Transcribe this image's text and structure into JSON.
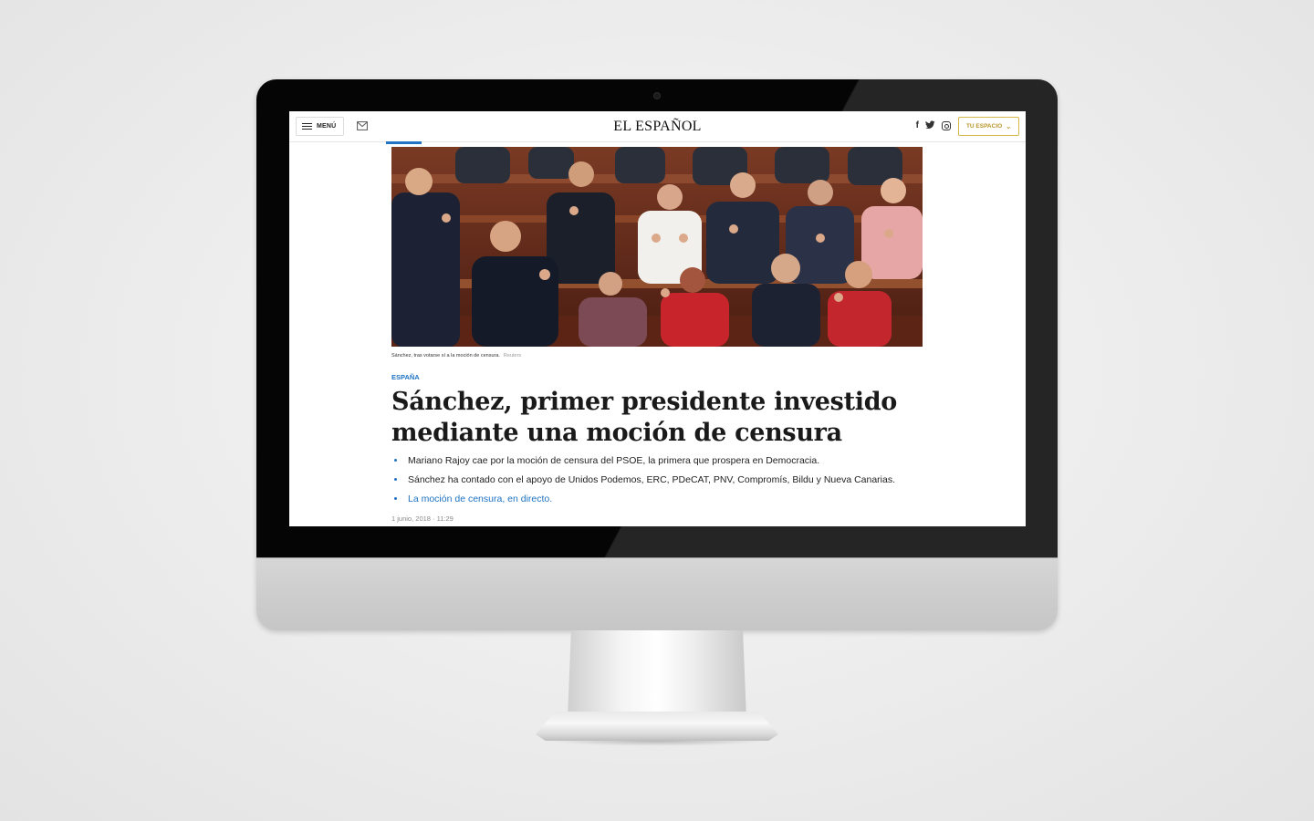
{
  "header": {
    "menu_label": "MENÚ",
    "logo": "EL ESPAÑOL",
    "tu_espacio_label": "TU ESPACIO",
    "social": [
      "facebook-icon",
      "twitter-icon",
      "instagram-icon"
    ]
  },
  "article": {
    "caption": "Sánchez, tras votarse sí a la moción de censura.",
    "credit": "Reuters",
    "section": "ESPAÑA",
    "headline_line1": "Sánchez, primer presidente investido",
    "headline_line2": "mediante una moción de censura",
    "bullets": [
      "Mariano Rajoy cae por la moción de censura del PSOE, la primera que prospera en Democracia.",
      "Sánchez ha contado con el apoyo de Unidos Podemos, ERC, PDeCAT, PNV, Compromís, Bildu y Nueva Canarias.",
      "La moción de censura, en directo."
    ],
    "date": "1 junio, 2018",
    "time": "11:29"
  },
  "colors": {
    "accent_blue": "#1f73c2",
    "tu_espacio_gold": "#b9962a",
    "bezel": "#050505"
  }
}
